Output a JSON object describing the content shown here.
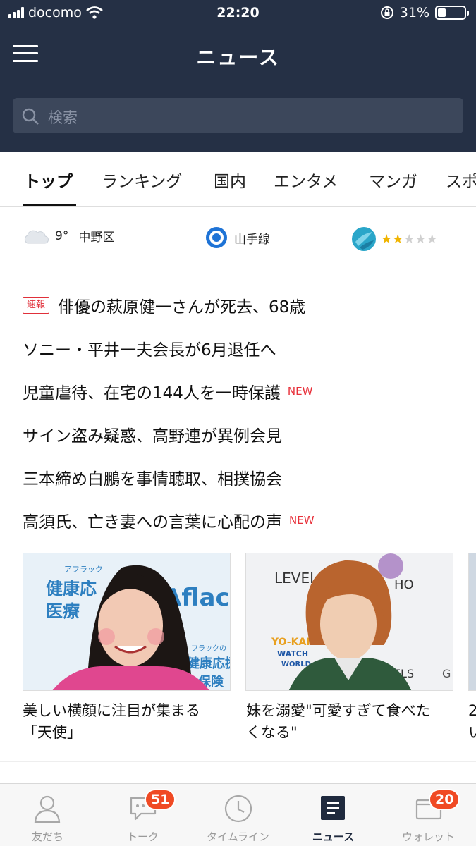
{
  "status_bar": {
    "carrier": "docomo",
    "time": "22:20",
    "battery_percent": "31%",
    "battery_level": 0.31
  },
  "header": {
    "title": "ニュース"
  },
  "search": {
    "placeholder": "検索"
  },
  "tabs": [
    "トップ",
    "ランキング",
    "国内",
    "エンタメ",
    "マンガ",
    "スポ"
  ],
  "active_tab": 0,
  "info": {
    "temperature": "9°",
    "location": "中野区",
    "train_line": "山手線",
    "fortune_rating": 2,
    "fortune_max": 5
  },
  "headlines": [
    {
      "text": "俳優の萩原健一さんが死去、68歳",
      "tag": "速報"
    },
    {
      "text": "ソニー・平井一夫会長が6月退任へ",
      "tag": ""
    },
    {
      "text": "児童虐待、在宅の144人を一時保護",
      "tag": "NEW"
    },
    {
      "text": "サイン盗み疑惑、高野連が異例会見",
      "tag": ""
    },
    {
      "text": "三本締め白鵬を事情聴取、相撲協会",
      "tag": ""
    },
    {
      "text": "高須氏、亡き妻への言葉に心配の声",
      "tag": "NEW"
    }
  ],
  "cards": [
    {
      "caption_line1": "美しい横顔に注目が集まる",
      "caption_line2": "「天使」",
      "image_text": [
        "アフラック",
        "健康応",
        "医療",
        "Aflac",
        "フラックの",
        "健康応援",
        "保険"
      ]
    },
    {
      "caption_line1": "妹を溺愛\"可愛すぎて食べた",
      "caption_line2": "くなる\"",
      "image_text": [
        "LEVEL",
        "HO",
        "YO-KAI",
        "WATCH",
        "WORLD",
        "VELS",
        "G"
      ]
    },
    {
      "caption_line1": "2",
      "caption_line2": "い"
    }
  ],
  "bottom_nav": [
    {
      "label": "友だち",
      "badge": ""
    },
    {
      "label": "トーク",
      "badge": "51"
    },
    {
      "label": "タイムライン",
      "badge": ""
    },
    {
      "label": "ニュース",
      "badge": ""
    },
    {
      "label": "ウォレット",
      "badge": "20"
    }
  ],
  "colors": {
    "header_bg": "#253045",
    "new_red": "#e8303a",
    "badge_orange": "#f04a24",
    "star_gold": "#f0b400",
    "train_blue": "#1e73d6"
  }
}
